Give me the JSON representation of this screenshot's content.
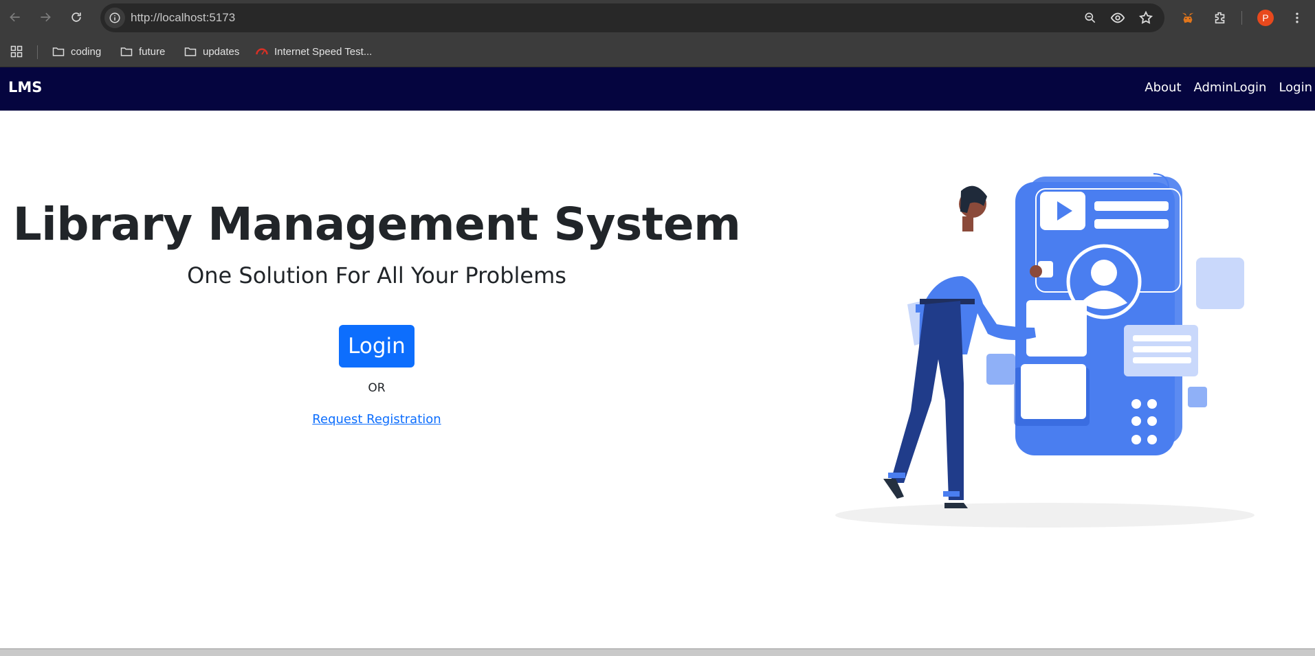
{
  "browser": {
    "url": "http://localhost:5173",
    "bookmarks": [
      {
        "label": "coding",
        "icon": "folder-icon"
      },
      {
        "label": "future",
        "icon": "folder-icon"
      },
      {
        "label": "updates",
        "icon": "folder-icon"
      },
      {
        "label": "Internet Speed Test...",
        "icon": "speedometer-icon"
      }
    ],
    "profile_initial": "P"
  },
  "navbar": {
    "brand": "LMS",
    "links": [
      "About",
      "AdminLogin",
      "Login"
    ],
    "background": "#05053f"
  },
  "hero": {
    "title": "Library Management System",
    "subtitle": "One Solution For All Your Problems",
    "login_button": "Login",
    "or_text": "OR",
    "register_link": "Request Registration",
    "accent": "#0d6efd"
  }
}
